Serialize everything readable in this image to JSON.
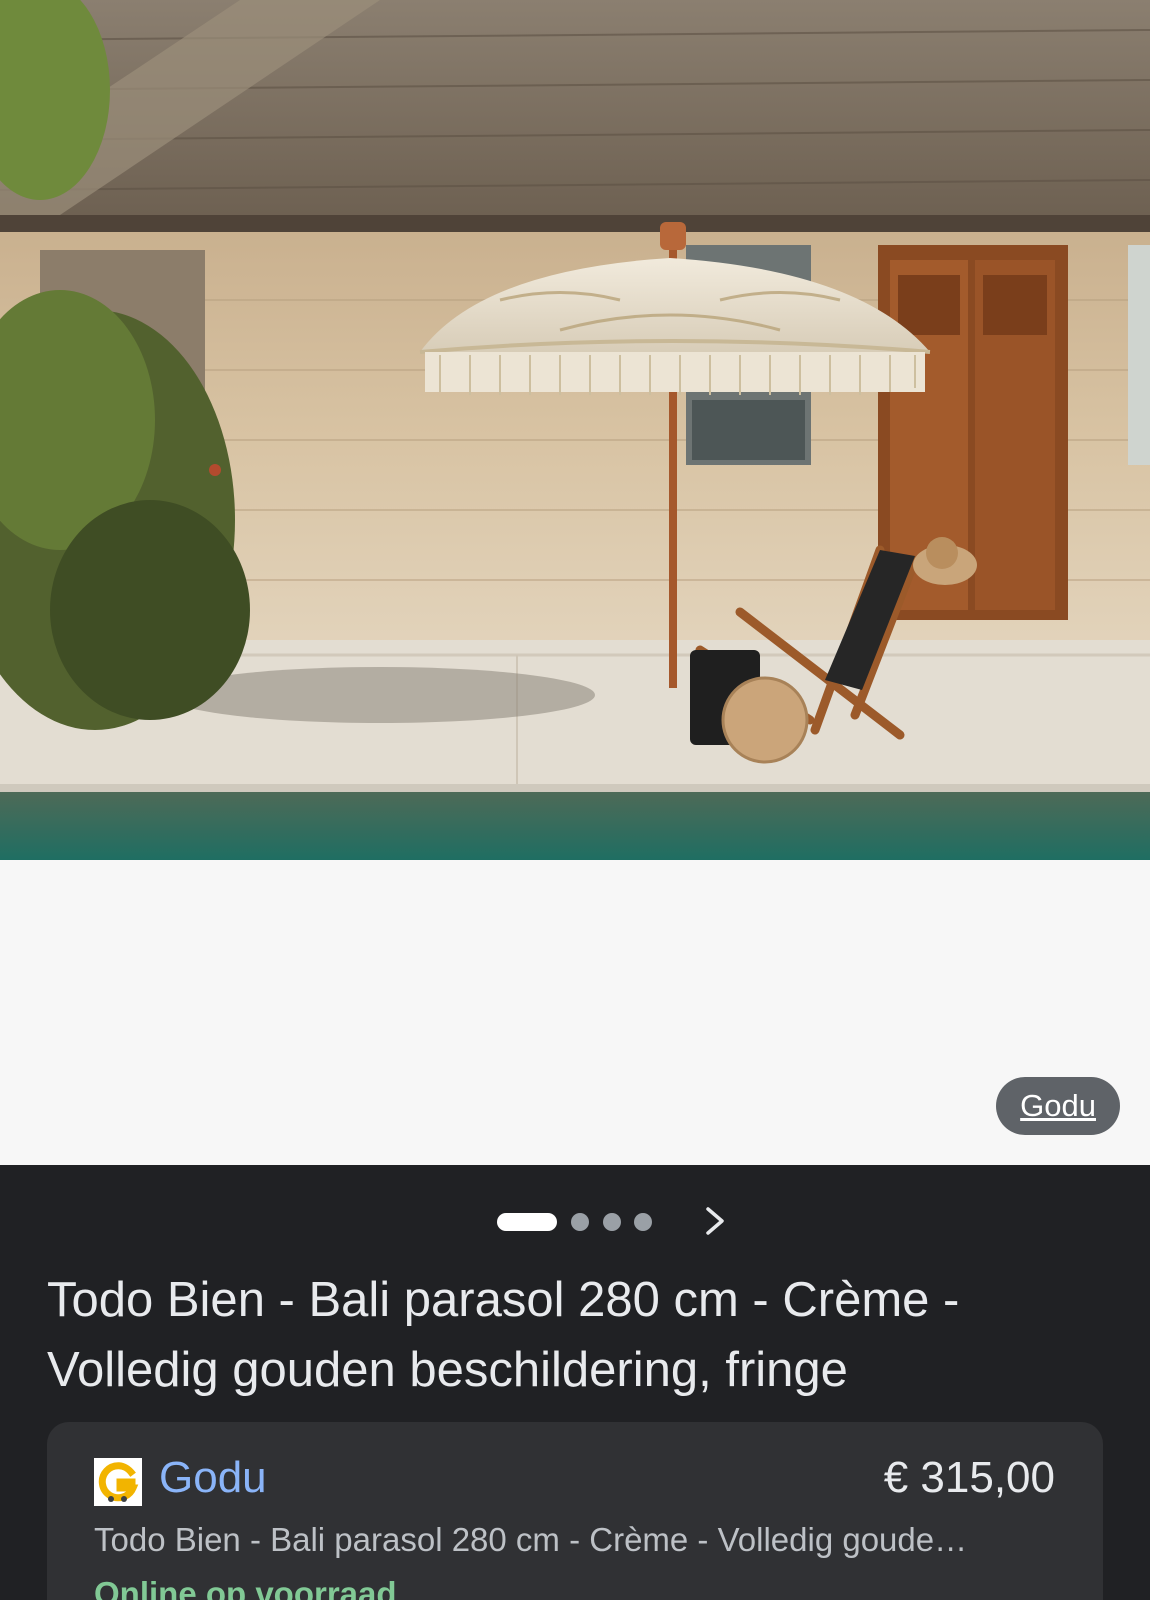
{
  "image_source_chip": {
    "label": "Godu"
  },
  "carousel": {
    "page_count": 4,
    "active_index": 0,
    "next_icon": "chevron-right-icon"
  },
  "product": {
    "title": "Todo Bien - Bali parasol 280 cm - Crème - Volledig gouden beschildering, fringe"
  },
  "offer": {
    "seller_logo_icon": "godu-logo-icon",
    "seller": "Godu",
    "price": "€ 315,00",
    "description": "Todo Bien - Bali parasol 280 cm - Crème - Volledig goude…",
    "stock": "Online op voorraad"
  },
  "colors": {
    "panel_bg": "#202124",
    "card_bg": "#303134",
    "link": "#8ab4f8",
    "stock": "#81c995"
  }
}
